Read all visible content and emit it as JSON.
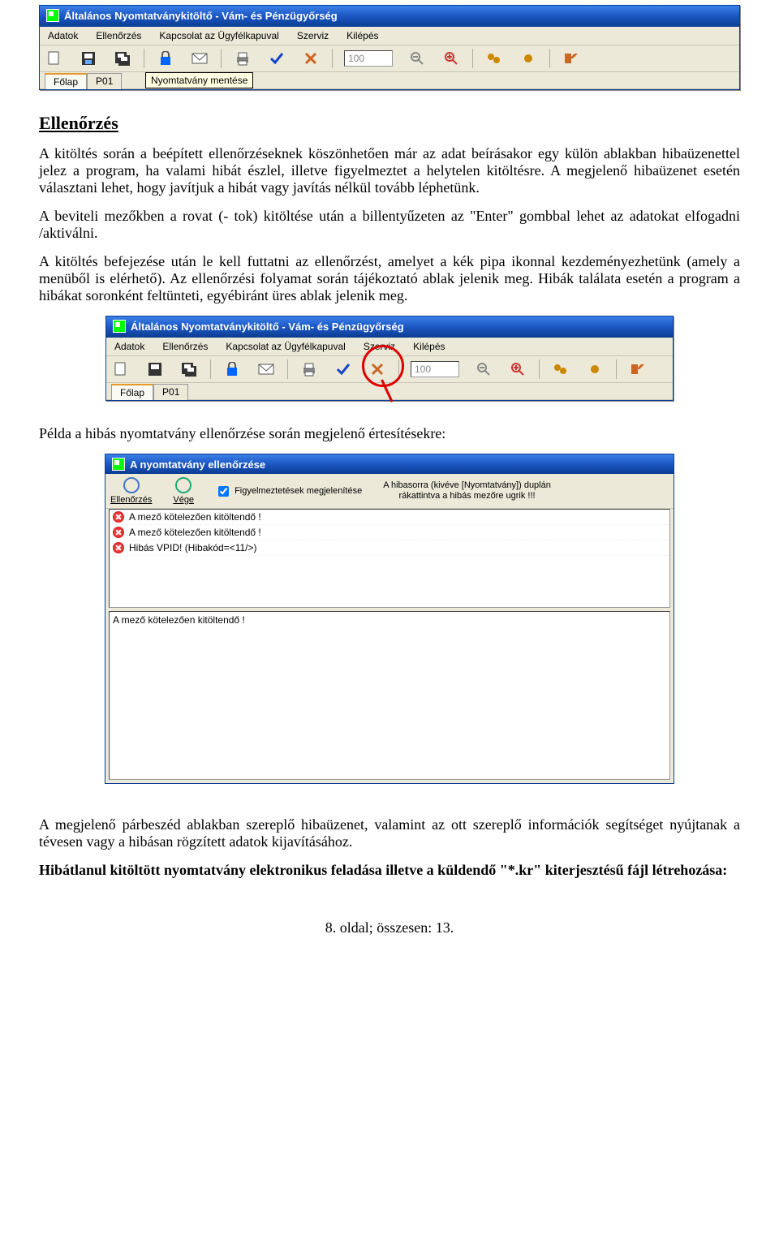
{
  "app": {
    "title": "Általános Nyomtatványkitöltő - Vám- és Pénzügyőrség",
    "menu": [
      "Adatok",
      "Ellenőrzés",
      "Kapcsolat az Ügyfélkapuval",
      "Szerviz",
      "Kilépés"
    ],
    "zoom": "100",
    "tabs": [
      "Főlap",
      "P01"
    ],
    "tooltip_save": "Nyomtatvány mentése"
  },
  "doc": {
    "heading": "Ellenőrzés",
    "p1": "A kitöltés során a beépített ellenőrzéseknek köszönhetően már az adat beírásakor egy külön ablakban hibaüzenettel jelez a program, ha valami hibát észlel, illetve figyelmeztet a helytelen kitöltésre. A megjelenő hibaüzenet esetén választani lehet, hogy javítjuk a hibát vagy javítás nélkül tovább léphetünk.",
    "p2": "A beviteli mezőkben a rovat (- tok) kitöltése után a billentyűzeten az \"Enter\" gombbal lehet az adatokat elfogadni /aktiválni.",
    "p3": "A kitöltés befejezése után le kell futtatni az ellenőrzést, amelyet a kék pipa ikonnal kezdeményezhetünk (amely a menüből is elérhető). Az ellenőrzési folyamat során tájékoztató ablak jelenik meg. Hibák találata esetén a program a hibákat soronként feltünteti, egyébiránt üres ablak jelenik meg.",
    "p4": "Példa a hibás nyomtatvány ellenőrzése során megjelenő értesítésekre:",
    "p5": "A megjelenő párbeszéd ablakban szereplő hibaüzenet, valamint az ott szereplő információk segítséget nyújtanak a tévesen vagy a hibásan rögzített adatok kijavításához.",
    "p6": "Hibátlanul kitöltött nyomtatvány elektronikus feladása illetve a küldendő \"*.kr\" kiterjesztésű fájl létrehozása:",
    "footer": "8. oldal; összesen: 13."
  },
  "dialog": {
    "title": "A nyomtatvány ellenőrzése",
    "btn_check": "Ellenőrzés",
    "btn_end": "Vége",
    "chk_label": "Figyelmeztetések megjelenítése",
    "hint1": "A hibasorra (kivéve [Nyomtatvány]) duplán",
    "hint2": "rákattintva a hibás  mezőre ugrik !!!",
    "errors": [
      "A mező kötelezően kitöltendő !",
      "A mező kötelezően kitöltendő !",
      "Hibás VPID! (Hibakód=<11/>)"
    ],
    "detail": "A mező kötelezően kitöltendő !"
  }
}
